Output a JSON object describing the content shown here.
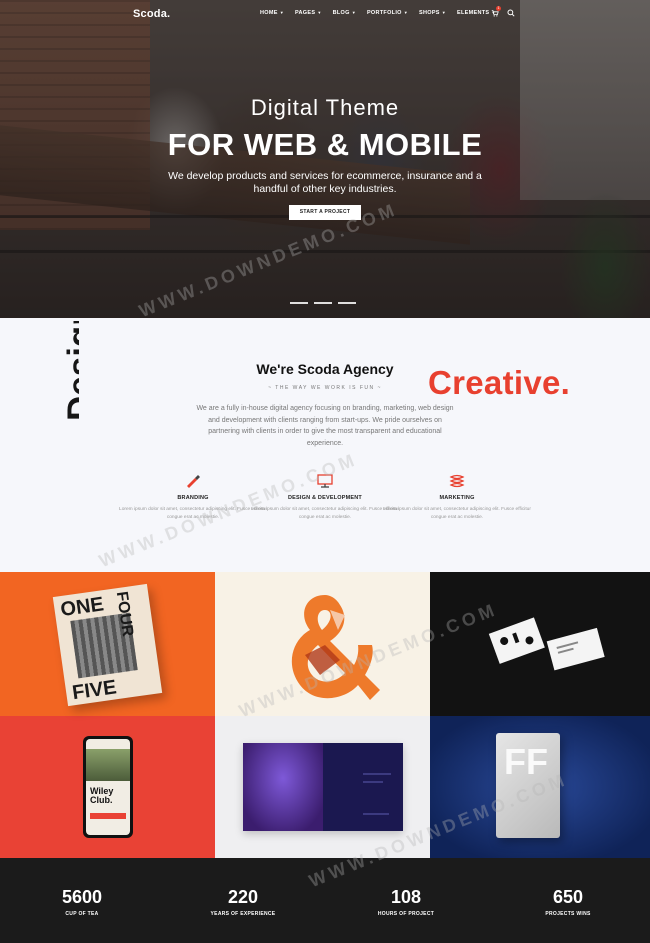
{
  "brand": {
    "logo": "Scoda."
  },
  "nav": {
    "items": [
      {
        "label": "HOME"
      },
      {
        "label": "PAGES"
      },
      {
        "label": "BLOG"
      },
      {
        "label": "PORTFOLIO"
      },
      {
        "label": "SHOPS"
      },
      {
        "label": "ELEMENTS"
      }
    ],
    "cart_count": "1"
  },
  "hero": {
    "subtitle": "Digital Theme",
    "title": "FOR WEB & MOBILE",
    "text": "We develop products and services for ecommerce, insurance and a handful of other key industries.",
    "button": "START A PROJECT"
  },
  "agency": {
    "side_word": "Design",
    "title": "We're Scoda Agency",
    "tagline": "~ THE WAY WE WORK IS FUN ~",
    "highlight": "Creative.",
    "text": "We are a fully in-house digital agency focusing on branding, marketing, web design and development with clients ranging from start-ups. We pride ourselves on partnering with clients in order to give the most transparent and educational experience.",
    "services": [
      {
        "title": "BRANDING",
        "text": "Lorem ipsum dolor sit amet, consectetur adipiscing elit. Fusce efficitur congue erat ac molestie."
      },
      {
        "title": "DESIGN & DEVELOPMENT",
        "text": "Lorem ipsum dolor sit amet, consectetur adipiscing elit. Fusce efficitur congue erat ac molestie."
      },
      {
        "title": "MARKETING",
        "text": "Lorem ipsum dolor sit amet, consectetur adipiscing elit. Fusce efficitur congue erat ac molestie."
      }
    ]
  },
  "portfolio": {
    "poster_words": [
      "ONE",
      "FOUR",
      "FIVE"
    ],
    "phone_title": "Wiley Club.",
    "bag_letters": "FF"
  },
  "stats": [
    {
      "value": "5600",
      "label": "CUP OF TEA"
    },
    {
      "value": "220",
      "label": "YEARS OF EXPERIENCE"
    },
    {
      "value": "108",
      "label": "HOURS OF PROJECT"
    },
    {
      "value": "650",
      "label": "PROJECTS WINS"
    }
  ],
  "watermark": "WWW.DOWNDEMO.COM",
  "colors": {
    "accent": "#e8402f",
    "dark": "#1b1b1b",
    "orange": "#f26522",
    "blue": "#0f2358"
  }
}
